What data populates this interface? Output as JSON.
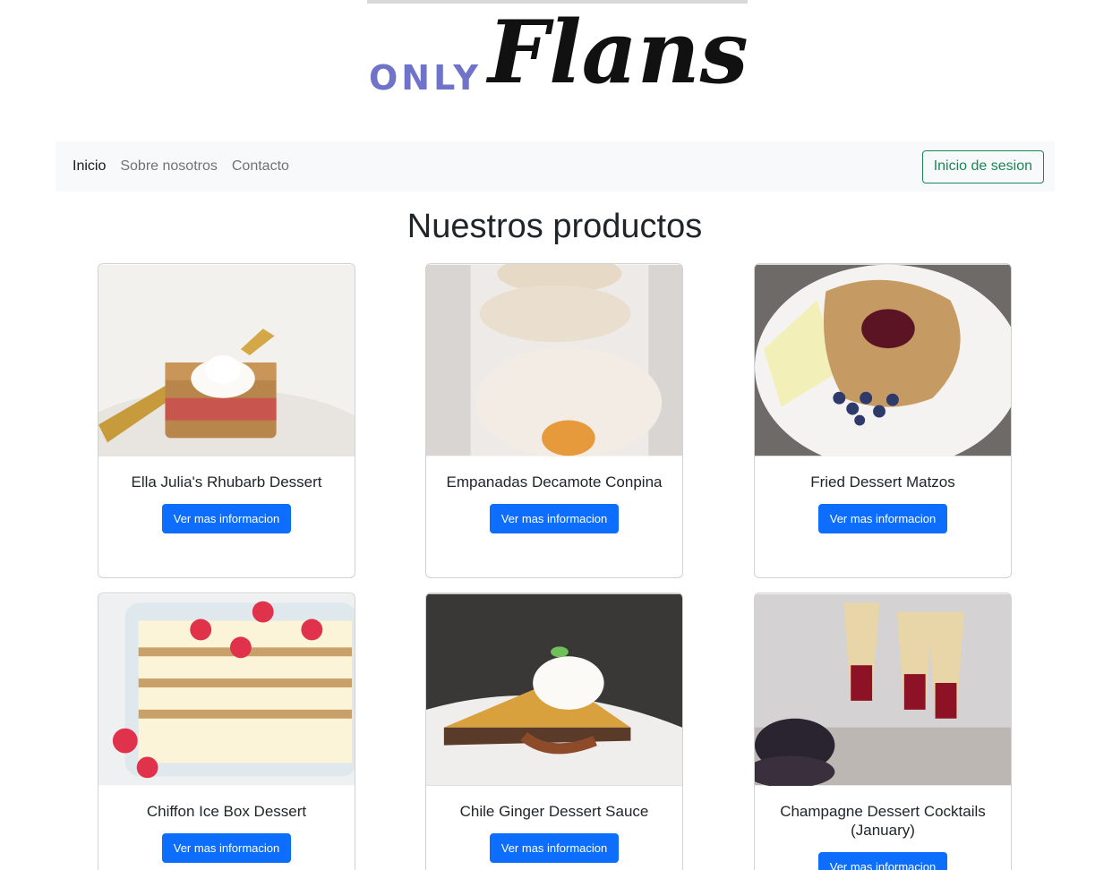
{
  "logo": {
    "prefix": "ONLY",
    "script": "Flans"
  },
  "nav": {
    "items": [
      {
        "label": "Inicio",
        "active": true
      },
      {
        "label": "Sobre nosotros",
        "active": false
      },
      {
        "label": "Contacto",
        "active": false
      }
    ],
    "login_label": "Inicio de sesion"
  },
  "main": {
    "title": "Nuestros productos",
    "products": [
      {
        "name": "Ella Julia's Rhubarb Dessert",
        "button": "Ver mas informacion",
        "image": "rhubarb-dessert-image"
      },
      {
        "name": "Empanadas Decamote Conpina",
        "button": "Ver mas informacion",
        "image": "empanadas-image"
      },
      {
        "name": "Fried Dessert Matzos",
        "button": "Ver mas informacion",
        "image": "matzos-plate-image"
      },
      {
        "name": "Chiffon Ice Box Dessert",
        "button": "Ver mas informacion",
        "image": "icebox-dessert-image"
      },
      {
        "name": "Chile Ginger Dessert Sauce",
        "button": "Ver mas informacion",
        "image": "ginger-sauce-image"
      },
      {
        "name": "Champagne Dessert Cocktails (January)",
        "button": "Ver mas informacion",
        "image": "champagne-cocktails-image"
      }
    ]
  },
  "colors": {
    "primary": "#0d6efd",
    "success": "#198754",
    "navbar_bg": "#f8f9fa",
    "logo_prefix": "#6f73c9"
  }
}
